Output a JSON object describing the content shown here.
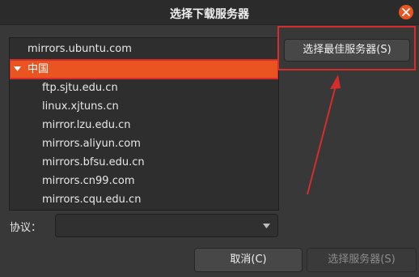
{
  "window": {
    "title": "选择下载服务器",
    "close_icon": "close-icon",
    "accent_color": "#e95420"
  },
  "server_list": {
    "top_item": "mirrors.ubuntu.com",
    "selected_group": {
      "label": "中国",
      "expanded": true,
      "expander_icon": "triangle-down-icon"
    },
    "items": [
      "ftp.sjtu.edu.cn",
      "linux.xjtuns.cn",
      "mirror.lzu.edu.cn",
      "mirrors.aliyun.com",
      "mirrors.bfsu.edu.cn",
      "mirrors.cn99.com",
      "mirrors.cqu.edu.cn"
    ]
  },
  "best_server_button": {
    "label": "选择最佳服务器(S)"
  },
  "protocol": {
    "label": "协议：",
    "value": "",
    "dropdown_icon": "chevron-down-icon"
  },
  "buttons": {
    "cancel": "取消(C)",
    "choose_server": "选择服务器(S)"
  },
  "annotation": {
    "color": "#d62c2c"
  }
}
